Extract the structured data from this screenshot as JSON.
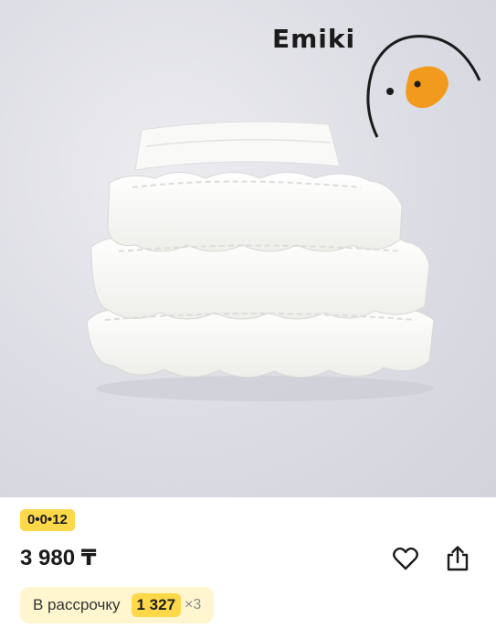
{
  "brand": {
    "name": "Emiki"
  },
  "product": {
    "image_alt": "white tiered ruffle skirt",
    "badge": "0•0•12",
    "price": "3 980 ₸",
    "installment": {
      "label": "В рассрочку",
      "amount": "1 327",
      "multiplier": "×3"
    }
  },
  "actions": {
    "favorite_icon": "heart-icon",
    "share_icon": "share-icon"
  },
  "colors": {
    "badge_bg": "#ffd84a",
    "installment_bg": "#fff6d0",
    "duck_beak": "#f29a1e"
  }
}
